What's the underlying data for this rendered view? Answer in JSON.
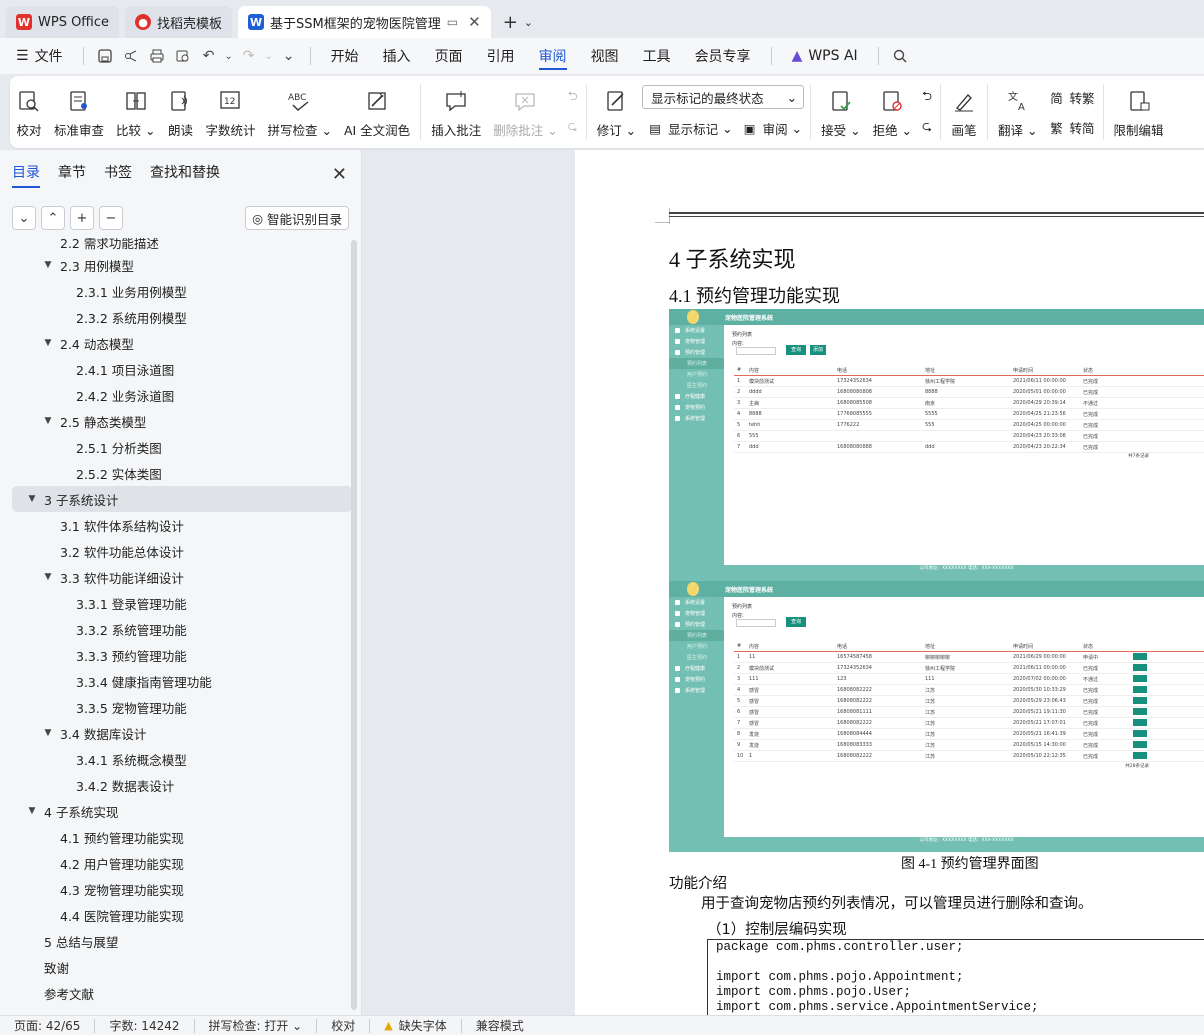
{
  "tabs": [
    {
      "label": "WPS Office",
      "icon": "wps-logo-icon",
      "color": "#e0322d"
    },
    {
      "label": "找稻壳模板",
      "icon": "docer-logo-icon",
      "color": "#e0322d"
    },
    {
      "label": "基于SSM框架的宠物医院管理",
      "icon": "word-doc-icon",
      "color": "#1f5fd6"
    }
  ],
  "menu": {
    "file": "文件",
    "items": [
      "开始",
      "插入",
      "页面",
      "引用",
      "审阅",
      "视图",
      "工具",
      "会员专享"
    ],
    "active": "审阅",
    "wps_ai": "WPS AI"
  },
  "ribbon": {
    "proofread": "校对",
    "standard_review": "标准审查",
    "compare": "比较",
    "read_aloud": "朗读",
    "word_count": "字数统计",
    "spell_check": "拼写检查",
    "ai_polish": "AI 全文润色",
    "insert_comment": "插入批注",
    "delete_comment": "删除批注",
    "revise": "修订",
    "display_mode": "显示标记的最终状态",
    "show_markup": "显示标记",
    "review": "审阅",
    "accept": "接受",
    "reject": "拒绝",
    "pen": "画笔",
    "translate": "翻译",
    "to_traditional": "转繁",
    "to_simplified": "转简",
    "restrict_edit": "限制编辑"
  },
  "panel": {
    "tabs": [
      "目录",
      "章节",
      "书签",
      "查找和替换"
    ],
    "active_tab": "目录",
    "smart_toc": "智能识别目录",
    "toc": [
      {
        "text": "2.2  需求功能描述",
        "level": 1,
        "arrow": ""
      },
      {
        "text": "2.3  用例模型",
        "level": 1,
        "arrow": "▼"
      },
      {
        "text": "2.3.1  业务用例模型",
        "level": 2,
        "arrow": ""
      },
      {
        "text": "2.3.2  系统用例模型",
        "level": 2,
        "arrow": ""
      },
      {
        "text": "2.4  动态模型",
        "level": 1,
        "arrow": "▼"
      },
      {
        "text": "2.4.1  项目泳道图",
        "level": 2,
        "arrow": ""
      },
      {
        "text": "2.4.2  业务泳道图",
        "level": 2,
        "arrow": ""
      },
      {
        "text": "2.5  静态类模型",
        "level": 1,
        "arrow": "▼"
      },
      {
        "text": "2.5.1  分析类图",
        "level": 2,
        "arrow": ""
      },
      {
        "text": "2.5.2  实体类图",
        "level": 2,
        "arrow": ""
      },
      {
        "text": "3  子系统设计",
        "level": 0,
        "arrow": "▼",
        "selected": true
      },
      {
        "text": "3.1  软件体系结构设计",
        "level": 1,
        "arrow": ""
      },
      {
        "text": "3.2  软件功能总体设计",
        "level": 1,
        "arrow": ""
      },
      {
        "text": "3.3  软件功能详细设计",
        "level": 1,
        "arrow": "▼"
      },
      {
        "text": "3.3.1  登录管理功能",
        "level": 2,
        "arrow": ""
      },
      {
        "text": "3.3.2  系统管理功能",
        "level": 2,
        "arrow": ""
      },
      {
        "text": "3.3.3  预约管理功能",
        "level": 2,
        "arrow": ""
      },
      {
        "text": "3.3.4  健康指南管理功能",
        "level": 2,
        "arrow": ""
      },
      {
        "text": "3.3.5  宠物管理功能",
        "level": 2,
        "arrow": ""
      },
      {
        "text": "3.4  数据库设计",
        "level": 1,
        "arrow": "▼"
      },
      {
        "text": "3.4.1  系统概念模型",
        "level": 2,
        "arrow": ""
      },
      {
        "text": "3.4.2  数据表设计",
        "level": 2,
        "arrow": ""
      },
      {
        "text": "4  子系统实现",
        "level": 0,
        "arrow": "▼"
      },
      {
        "text": "4.1  预约管理功能实现",
        "level": 1,
        "arrow": ""
      },
      {
        "text": "4.2  用户管理功能实现",
        "level": 1,
        "arrow": ""
      },
      {
        "text": "4.3  宠物管理功能实现",
        "level": 1,
        "arrow": ""
      },
      {
        "text": "4.4  医院管理功能实现",
        "level": 1,
        "arrow": ""
      },
      {
        "text": "5  总结与展望",
        "level": 0,
        "arrow": ""
      },
      {
        "text": "致谢",
        "level": 0,
        "arrow": ""
      },
      {
        "text": "参考文献",
        "level": 0,
        "arrow": ""
      }
    ]
  },
  "document": {
    "heading1": "4  子系统实现",
    "heading2": "4.1  预约管理功能实现",
    "figure": {
      "app_title": "宠物医院管理系统",
      "tab_label": "预约列表",
      "search_label": "内容:",
      "btn_query": "查询",
      "btn_add": "添加",
      "sidebar": [
        "系统设置",
        "宠物管理",
        "预约管理",
        "预约列表",
        "用户预约",
        "医生预约",
        "疗程健康",
        "宠物预约",
        "系统管理"
      ],
      "columns": [
        "#",
        "内容",
        "电话",
        "地址",
        "申请时间",
        "状态"
      ],
      "rows1": [
        [
          "1",
          "模块前测试",
          "17324352634",
          "徐州工程学院",
          "2021/06/11 00:00:00",
          "已完成"
        ],
        [
          "2",
          "dddd",
          "16808080808",
          "8888",
          "2020/05/01 00:00:00",
          "已完成"
        ],
        [
          "3",
          "主病",
          "16808085508",
          "南京",
          "2020/04/29 20:39:14",
          "不通过"
        ],
        [
          "4",
          "8888",
          "17768085555",
          "5555",
          "2020/04/25 21:23:56",
          "已完成"
        ],
        [
          "5",
          "tehh",
          "1776222",
          "555",
          "2020/04/25 00:00:00",
          "已完成"
        ],
        [
          "6",
          "555",
          "",
          "",
          "2020/04/23 20:33:08",
          "已完成"
        ],
        [
          "7",
          "ddd",
          "16808080888",
          "ddd",
          "2020/04/23 20:22:34",
          "已完成"
        ]
      ],
      "rows2": [
        [
          "1",
          "11",
          "16574587458",
          "柳柳柳柳柳",
          "2021/06/29 00:00:00",
          "申请中"
        ],
        [
          "2",
          "模块前测试",
          "17324352634",
          "徐州工程学院",
          "2021/06/11 00:00:00",
          "已完成"
        ],
        [
          "3",
          "111",
          "123",
          "111",
          "2020/07/02 00:00:00",
          "不通过"
        ],
        [
          "4",
          "感冒",
          "16808082222",
          "江苏",
          "2020/05/30 10:33:29",
          "已完成"
        ],
        [
          "5",
          "感冒",
          "16808082222",
          "江苏",
          "2020/05/29 23:06:43",
          "已完成"
        ],
        [
          "6",
          "感冒",
          "16808081111",
          "江苏",
          "2020/05/21 19:11:30",
          "已完成"
        ],
        [
          "7",
          "感冒",
          "16808082222",
          "江苏",
          "2020/05/21 17:07:01",
          "已完成"
        ],
        [
          "8",
          "发烧",
          "16808084444",
          "江苏",
          "2020/05/21 16:41:39",
          "已完成"
        ],
        [
          "9",
          "发烧",
          "16808083333",
          "江苏",
          "2020/05/15 14:30:00",
          "已完成"
        ],
        [
          "10",
          "1",
          "16808082222",
          "江苏",
          "2020/05/10 22:12:35",
          "已完成"
        ]
      ],
      "pager1": "共7条记录",
      "pager2": "共28条记录",
      "footer": "公司地址：XXXXXXXX  电话：XXX-XXXXXXX"
    },
    "caption": "图 4-1 预约管理界面图",
    "para_title": "功能介绍",
    "para_text": "用于查询宠物店预约列表情况，可以管理员进行删除和查询。",
    "sub_title": "（1）控制层编码实现",
    "code": [
      "package com.phms.controller.user;",
      "",
      "import com.phms.pojo.Appointment;",
      "import com.phms.pojo.User;",
      "import com.phms.service.AppointmentService;"
    ]
  },
  "status": {
    "page": "页面: 42/65",
    "words": "字数: 14242",
    "spell": "拼写检查: 打开",
    "proof": "校对",
    "missing_font": "缺失字体",
    "compat": "兼容模式"
  },
  "colors": {
    "accent": "#1f57d6",
    "figure_teal": "#74bfb3",
    "button_teal": "#18907e"
  }
}
